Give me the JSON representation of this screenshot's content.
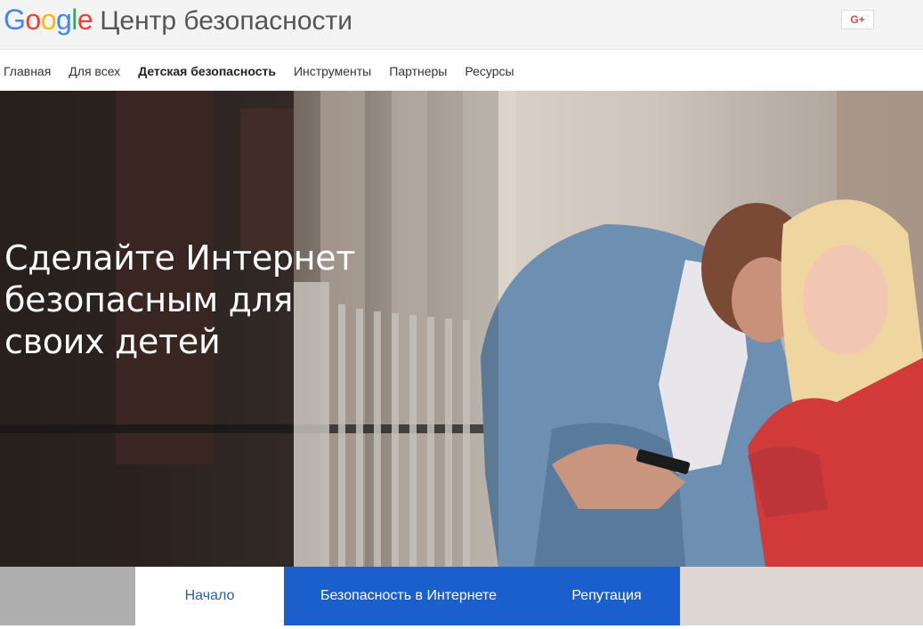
{
  "header": {
    "logo_text": "Google",
    "site_title": "Центр безопасности",
    "share_button": "G+",
    "colors": {
      "blue": "#4285F4",
      "red": "#EA4335",
      "yellow": "#FBBC05",
      "green": "#34A853"
    }
  },
  "nav": {
    "items": [
      {
        "label": "Главная"
      },
      {
        "label": "Для всех"
      },
      {
        "label": "Детская безопасность",
        "active": true
      },
      {
        "label": "Инструменты"
      },
      {
        "label": "Партнеры"
      },
      {
        "label": "Ресурсы"
      }
    ]
  },
  "hero": {
    "line1": "Сделайте Интернет",
    "line2": "безопасным для",
    "line3": "своих детей"
  },
  "tabs": {
    "start": "Начало",
    "online_safety": "Безопасность в Интернете",
    "reputation": "Репутация",
    "accent": "#1b5fcc"
  }
}
